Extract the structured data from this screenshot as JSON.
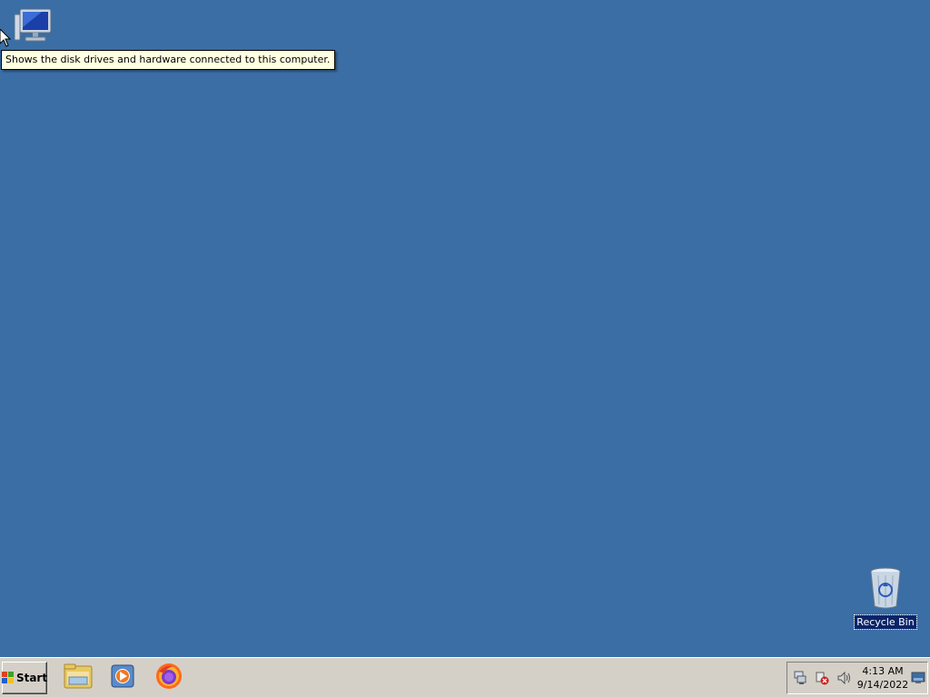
{
  "desktop": {
    "background_color": "#3a6ea5",
    "icons": [
      {
        "name": "computer-icon",
        "label": ""
      },
      {
        "name": "recycle-bin-icon",
        "label": "Recycle Bin"
      }
    ],
    "tooltip": "Shows the disk drives and hardware connected to this computer."
  },
  "taskbar": {
    "start_label": "Start",
    "quick_launch": [
      {
        "icon": "folder-explorer-icon"
      },
      {
        "icon": "media-player-icon"
      },
      {
        "icon": "firefox-icon"
      }
    ],
    "tray": {
      "icons": [
        "network-icon",
        "security-warning-icon",
        "volume-icon",
        "show-desktop-icon"
      ],
      "time": "4:13 AM",
      "date": "9/14/2022"
    }
  }
}
